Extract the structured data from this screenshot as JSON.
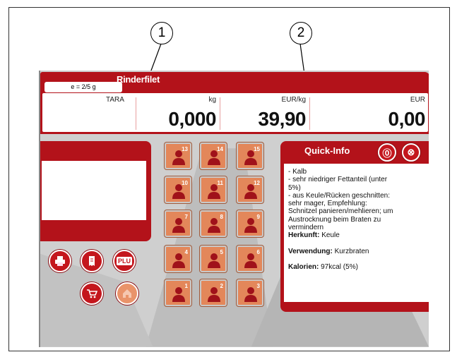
{
  "callouts": [
    "1",
    "2"
  ],
  "header": {
    "title": "Rinderfilet",
    "tare_limit": "e = 2/5 g"
  },
  "weigh": {
    "tara_label": "TARA",
    "weight_unit": "kg",
    "weight_value": "0,000",
    "price_unit": "EUR/kg",
    "price_value": "39,90",
    "total_unit": "EUR",
    "total_value": "0,00"
  },
  "left_buttons": [
    {
      "icon": "printer-icon"
    },
    {
      "icon": "receipt-icon"
    },
    {
      "icon": "plu-icon",
      "label": "PLU"
    },
    {
      "icon": "cart-icon"
    },
    {
      "icon": "home-icon"
    }
  ],
  "keys": [
    [
      "13",
      "14",
      "15"
    ],
    [
      "10",
      "11",
      "12"
    ],
    [
      "7",
      "8",
      "9"
    ],
    [
      "4",
      "5",
      "6"
    ],
    [
      "1",
      "2",
      "3"
    ]
  ],
  "quick_info": {
    "title": "Quick-Info",
    "info_button": "⓪",
    "close_button": "⊗",
    "lines": [
      "- Kalb",
      "- sehr niedriger Fettanteil (unter",
      "5%)",
      "- aus Keule/Rücken geschnitten:",
      "sehr mager, Empfehlung:",
      "Schnitzel panieren/mehlieren; um",
      "Austrocknung beim Braten zu",
      "vermindern"
    ],
    "origin_label": "Herkunft:",
    "origin_value": " Keule",
    "use_label": "Verwendung:",
    "use_value": " Kurzbraten",
    "calories_label": "Kalorien:",
    "calories_value": " 97kcal (5%)"
  },
  "colors": {
    "brand_red": "#b3121a",
    "key_orange": "#e3875a"
  }
}
